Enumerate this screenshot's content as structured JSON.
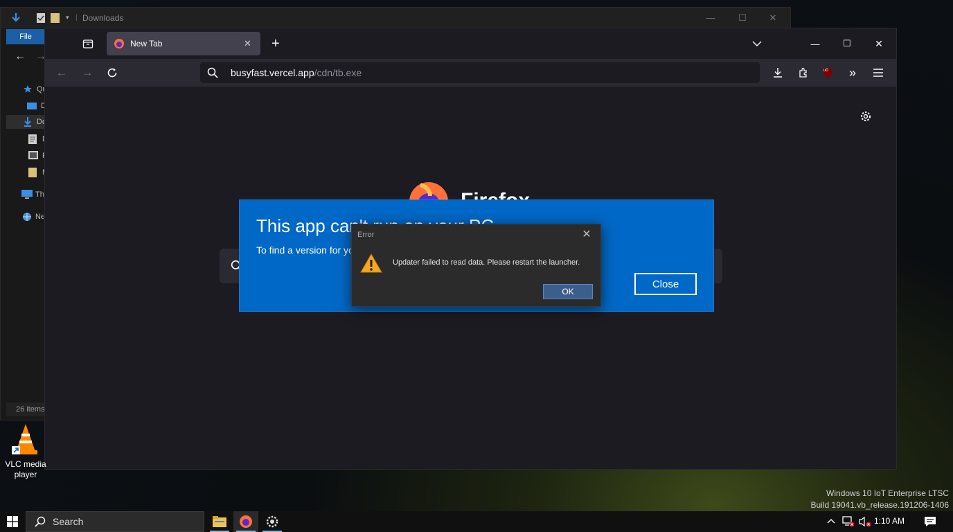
{
  "explorer": {
    "title": "Downloads",
    "file_tab": "File",
    "sidebar": [
      {
        "label": "Quick access",
        "icon": "star-icon"
      },
      {
        "label": "Desktop",
        "icon": "desktop-folder-icon"
      },
      {
        "label": "Downloads",
        "icon": "download-folder-icon"
      },
      {
        "label": "Documents",
        "icon": "documents-folder-icon"
      },
      {
        "label": "Pictures",
        "icon": "pictures-folder-icon"
      },
      {
        "label": "Music",
        "icon": "folder-icon"
      },
      {
        "label": "This PC",
        "icon": "computer-icon"
      },
      {
        "label": "Network",
        "icon": "network-icon"
      }
    ],
    "status": "26 items"
  },
  "firefox": {
    "tab_title": "New Tab",
    "url_host": "busyfast.vercel.app",
    "url_path": "/cdn/tb.exe",
    "brand_text": "Firefox",
    "ublock_badge": "u0"
  },
  "cantrun_dialog": {
    "headline": "This app can't run on your PC",
    "subtext": "To find a version for your PC, check with the software publisher.",
    "close_label": "Close"
  },
  "error_dialog": {
    "title": "Error",
    "message": "Updater failed to read data. Please restart the launcher.",
    "ok_label": "OK"
  },
  "desktop": {
    "vlc_label": "VLC media player"
  },
  "watermark": {
    "line1": "Windows 10 IoT Enterprise LTSC",
    "line2": "Build 19041.vb_release.191206-1406"
  },
  "taskbar": {
    "search_label": "Search",
    "clock": "1:10 AM"
  },
  "colors": {
    "dialog_blue": "#0068c6",
    "taskbar_accent": "#76b9ed",
    "firefox_bg": "#1c1b22"
  }
}
